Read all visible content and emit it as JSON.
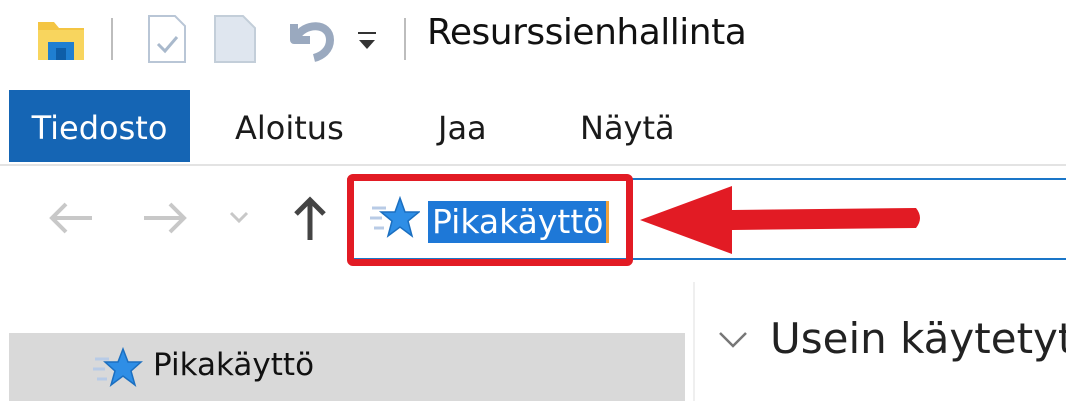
{
  "window": {
    "title": "Resurssienhallinta",
    "quick_access_toolbar": [
      "folder-icon",
      "properties-icon",
      "new-folder-icon",
      "undo-icon",
      "customize-dropdown-icon"
    ]
  },
  "ribbon": {
    "tabs": [
      {
        "label": "Tiedosto",
        "active": true
      },
      {
        "label": "Aloitus"
      },
      {
        "label": "Jaa"
      },
      {
        "label": "Näytä"
      }
    ]
  },
  "navigation": {
    "buttons": [
      "back-arrow-icon",
      "forward-arrow-icon",
      "recent-locations-chevron-icon",
      "up-arrow-icon"
    ],
    "address": {
      "icon": "quick-access-star-icon",
      "text": "Pikakäyttö",
      "selected": true
    }
  },
  "annotation": {
    "color": "#e21b24",
    "shape": "box-with-arrow",
    "target": "address-bar"
  },
  "nav_pane": {
    "items": [
      {
        "label": "Pikakäyttö",
        "icon": "quick-access-star-icon",
        "selected": true
      }
    ]
  },
  "content": {
    "section": {
      "label": "Usein käytetyt",
      "expanded": true
    }
  },
  "colors": {
    "accent": "#1565b4",
    "selection": "#1e78d7",
    "annotation": "#e21b24"
  }
}
